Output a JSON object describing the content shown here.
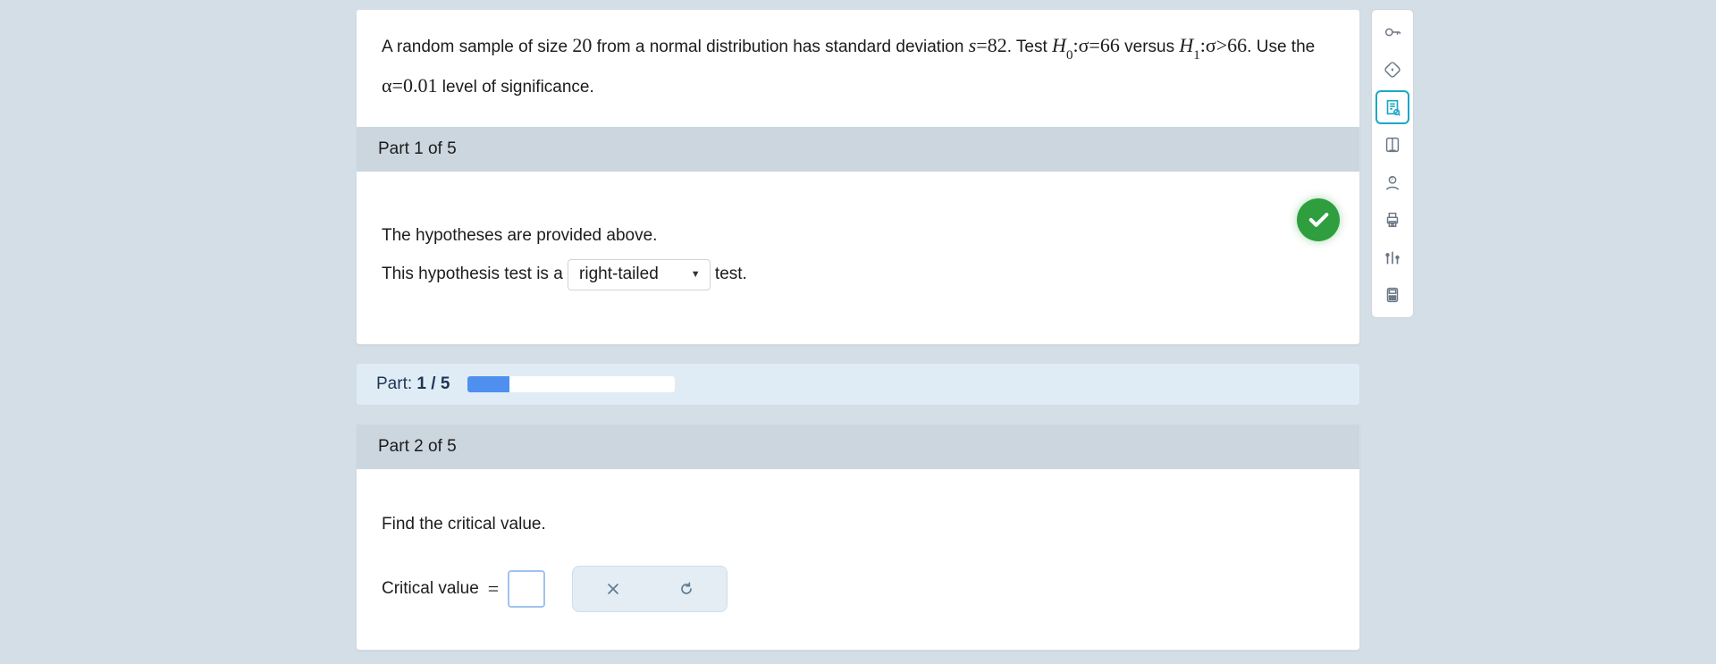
{
  "question": {
    "intro_a": "A random sample of size ",
    "n": "20",
    "intro_b": " from a normal distribution has standard deviation ",
    "s_eq": "s",
    "s_op": "=",
    "s_val": "82",
    "intro_c": ". Test ",
    "H0": "H",
    "H0_sub": "0",
    "H_colon": ":",
    "sigma": "σ",
    "eq": "=",
    "sigma0": "66",
    "versus": " versus ",
    "H1": "H",
    "H1_sub": "1",
    "gt": ">",
    "sigma1": "66",
    "intro_d": ". Use the ",
    "alpha": "α",
    "alpha_val": "0.01",
    "intro_e": " level of significance."
  },
  "part1": {
    "header": "Part 1 of 5",
    "line1": "The hypotheses are provided above.",
    "line2a": "This hypothesis test is a ",
    "dropdown_value": "right-tailed",
    "line2b": " test."
  },
  "progress": {
    "label_prefix": "Part: ",
    "current": "1",
    "sep": " / ",
    "total": "5",
    "percent": 20
  },
  "part2": {
    "header": "Part 2 of 5",
    "prompt": "Find the critical value.",
    "label": "Critical value",
    "eq": "="
  }
}
